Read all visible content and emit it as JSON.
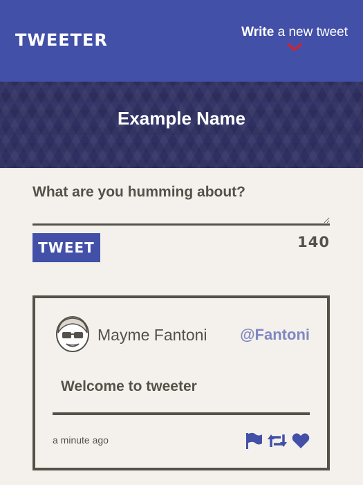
{
  "nav": {
    "brand": "TWEETER",
    "compose_bold": "Write",
    "compose_rest": " a new tweet",
    "compose_icon": "chevron-down-icon",
    "compose_icon_color": "#d0232f"
  },
  "banner": {
    "user_name": "Example Name"
  },
  "composer": {
    "prompt": "What are you humming about?",
    "value": "",
    "button_label": "TWEET",
    "char_count": "140"
  },
  "tweet": {
    "author_name": "Mayme Fantoni",
    "handle": "@Fantoni",
    "content": "Welcome to tweeter",
    "timestamp": "a minute ago",
    "actions": [
      "flag-icon",
      "retweet-icon",
      "heart-icon"
    ]
  },
  "colors": {
    "primary": "#4350a8",
    "banner": "#2f3062",
    "background": "#f4f1ec",
    "text": "#545149",
    "handle": "#8087c2"
  }
}
